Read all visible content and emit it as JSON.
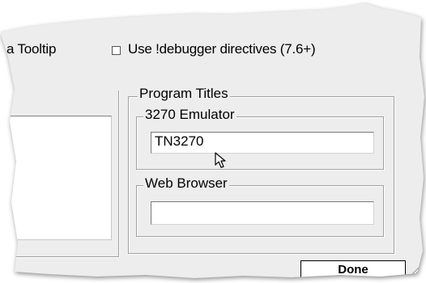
{
  "options": {
    "tooltip_label": "a Tooltip",
    "debugger_label": "Use !debugger directives (7.6+)",
    "debugger_checked": false
  },
  "program_titles": {
    "legend": "Program Titles",
    "emulator": {
      "legend": "3270 Emulator",
      "value": "TN3270"
    },
    "browser": {
      "legend": "Web Browser",
      "value": ""
    }
  },
  "buttons": {
    "done_label": "Done"
  },
  "icons": {
    "cursor": "mouse-pointer-icon",
    "grip": "resize-grip-icon"
  },
  "colors": {
    "dialog_bg": "#ededed",
    "field_bg": "#ffffff",
    "text": "#000000"
  }
}
